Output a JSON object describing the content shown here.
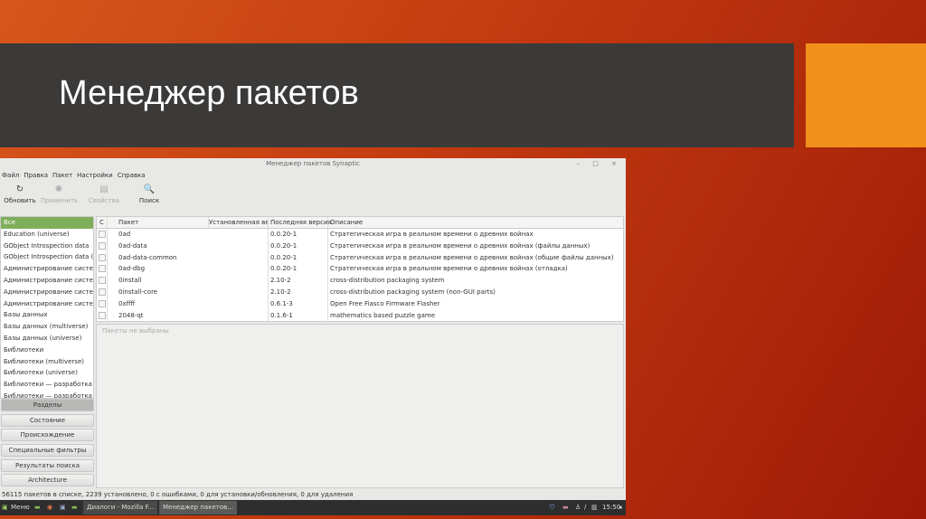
{
  "slide": {
    "title": "Менеджер пакетов"
  },
  "window": {
    "title": "Менеджер пакетов Synaptic",
    "controls": "– □ ×"
  },
  "menu": [
    "Файл",
    "Правка",
    "Пакет",
    "Настройки",
    "Справка"
  ],
  "toolbar": [
    {
      "label": "Обновить",
      "icon": "↻"
    },
    {
      "label": "Применить",
      "icon": "✺"
    },
    {
      "label": "Свойства",
      "icon": "▤"
    },
    {
      "label": "Поиск",
      "icon": "🔍"
    }
  ],
  "sections": [
    "Все",
    "Education (universe)",
    "GObject Introspection data",
    "GObject Introspection data (universe)",
    "Администрирование системы",
    "Администрирование системы (r",
    "Администрирование системы (r",
    "Администрирование системы (u",
    "Базы данных",
    "Базы данных (multiverse)",
    "Базы данных (universe)",
    "Библиотеки",
    "Библиотеки (multiverse)",
    "Библиотеки (universe)",
    "Библиотеки — разработка",
    "Библиотеки — разработка (multi"
  ],
  "filter_buttons": [
    "Разделы",
    "Состояние",
    "Происхождение",
    "Специальные фильтры",
    "Результаты поиска",
    "Architecture"
  ],
  "columns": [
    "С",
    "",
    "Пакет",
    "Установленная верс",
    "Последняя версия",
    "Описание"
  ],
  "packages": [
    {
      "name": "0ad",
      "installed": "",
      "latest": "0.0.20-1",
      "desc": "Стратегическая игра в реальном времени о древних войнах"
    },
    {
      "name": "0ad-data",
      "installed": "",
      "latest": "0.0.20-1",
      "desc": "Стратегическая игра в реальном времени о древних войнах (файлы данных)"
    },
    {
      "name": "0ad-data-common",
      "installed": "",
      "latest": "0.0.20-1",
      "desc": "Стратегическая игра в реальном времени о древних войнах (общие файлы данных)"
    },
    {
      "name": "0ad-dbg",
      "installed": "",
      "latest": "0.0.20-1",
      "desc": "Стратегическая игра в реальном времени о древних войнах (отладка)"
    },
    {
      "name": "0install",
      "installed": "",
      "latest": "2.10-2",
      "desc": "cross-distribution packaging system"
    },
    {
      "name": "0install-core",
      "installed": "",
      "latest": "2.10-2",
      "desc": "cross-distribution packaging system (non-GUI parts)"
    },
    {
      "name": "0xffff",
      "installed": "",
      "latest": "0.6.1-3",
      "desc": "Open Free Fiasco Firmware Flasher"
    },
    {
      "name": "2048-qt",
      "installed": "",
      "latest": "0.1.6-1",
      "desc": "mathematics based puzzle game"
    }
  ],
  "details": {
    "text": "Пакеты не выбраны"
  },
  "status": "56115 пакетов в списке, 2239 установлено, 0 с ошибками, 0 для установки/обновления, 0 для удаления",
  "taskbar": {
    "menu": "Меню",
    "tasks": [
      "Диалоги - Mozilla F...",
      "Менеджер пакетов..."
    ],
    "clock": "15:50"
  }
}
